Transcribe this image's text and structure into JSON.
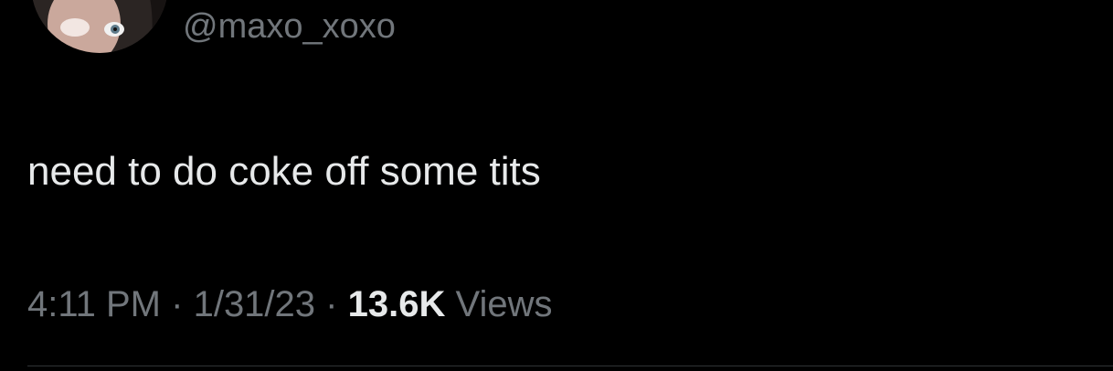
{
  "tweet": {
    "handle": "@maxo_xoxo",
    "text": "need to do coke off some tits",
    "time": "4:11 PM",
    "date": "1/31/23",
    "separator": "·",
    "views_count": "13.6K",
    "views_label": "Views"
  },
  "colors": {
    "background": "#000000",
    "primary_text": "#e7e9ea",
    "secondary_text": "#71767b",
    "divider": "#2f3336"
  }
}
